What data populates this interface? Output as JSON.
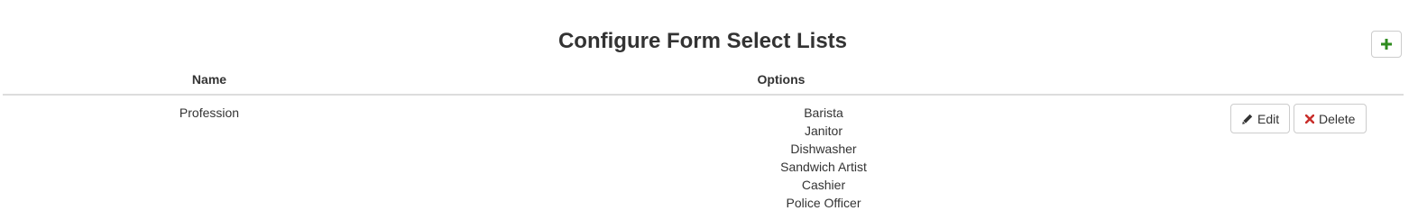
{
  "page": {
    "title": "Configure Form Select Lists",
    "add_button_icon": "plus-icon",
    "accent_color": "#2e8b1e"
  },
  "table": {
    "headers": {
      "name": "Name",
      "options": "Options"
    },
    "rows": [
      {
        "name": "Profession",
        "options": [
          "Barista",
          "Janitor",
          "Dishwasher",
          "Sandwich Artist",
          "Cashier",
          "Police Officer"
        ],
        "actions": {
          "edit_label": "Edit",
          "edit_icon": "pencil-icon",
          "delete_label": "Delete",
          "delete_icon": "x-icon",
          "delete_icon_color": "#c9302c"
        }
      }
    ]
  }
}
